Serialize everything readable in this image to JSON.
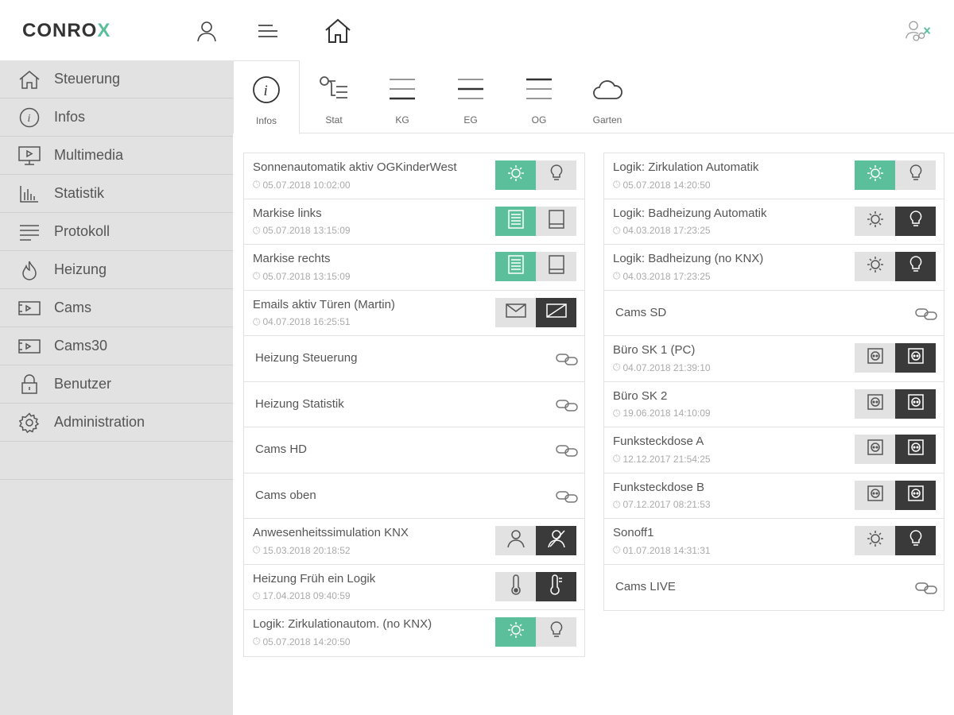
{
  "header": {
    "logo_main": "CONRO",
    "logo_accent": "X",
    "icons": [
      "user-icon",
      "menu-icon",
      "home-icon",
      "logout-icon"
    ]
  },
  "sidebar": {
    "items": [
      {
        "label": "Steuerung",
        "icon": "home-icon"
      },
      {
        "label": "Infos",
        "icon": "info-icon"
      },
      {
        "label": "Multimedia",
        "icon": "monitor-icon"
      },
      {
        "label": "Statistik",
        "icon": "bar-chart-icon"
      },
      {
        "label": "Protokoll",
        "icon": "list-icon"
      },
      {
        "label": "Heizung",
        "icon": "flame-icon"
      },
      {
        "label": "Cams",
        "icon": "camera-icon"
      },
      {
        "label": "Cams30",
        "icon": "camera-icon"
      },
      {
        "label": "Benutzer",
        "icon": "lock-icon"
      },
      {
        "label": "Administration",
        "icon": "gear-icon"
      }
    ]
  },
  "tabs": [
    {
      "label": "Infos",
      "icon": "info-icon",
      "active": true
    },
    {
      "label": "Stat",
      "icon": "status-list-icon"
    },
    {
      "label": "KG",
      "icon": "floor-lines-icon"
    },
    {
      "label": "EG",
      "icon": "floor-lines-icon"
    },
    {
      "label": "OG",
      "icon": "floor-lines-icon"
    },
    {
      "label": "Garten",
      "icon": "cloud-icon"
    }
  ],
  "left_panel": [
    {
      "name": "Sonnenautomatik aktiv OGKinderWest",
      "time": "05.07.2018 10:02:00",
      "kind": "sun"
    },
    {
      "name": "Markise links",
      "time": "05.07.2018 13:15:09",
      "kind": "awning"
    },
    {
      "name": "Markise rechts",
      "time": "05.07.2018 13:15:09",
      "kind": "awning"
    },
    {
      "name": "Emails aktiv Türen (Martin)",
      "time": "04.07.2018 16:25:51",
      "kind": "mail"
    },
    {
      "name": "Heizung Steuerung",
      "kind": "link"
    },
    {
      "name": "Heizung Statistik",
      "kind": "link"
    },
    {
      "name": "Cams HD",
      "kind": "link"
    },
    {
      "name": "Cams oben",
      "kind": "link"
    },
    {
      "name": "Anwesenheitssimulation KNX",
      "time": "15.03.2018 20:18:52",
      "kind": "presence"
    },
    {
      "name": "Heizung Früh ein Logik",
      "time": "17.04.2018 09:40:59",
      "kind": "thermo"
    },
    {
      "name": "Logik: Zirkulationautom. (no KNX)",
      "time": "05.07.2018 14:20:50",
      "kind": "sun"
    }
  ],
  "right_panel": [
    {
      "name": "Logik: Zirkulation Automatik",
      "time": "05.07.2018 14:20:50",
      "kind": "sun"
    },
    {
      "name": "Logik: Badheizung Automatik",
      "time": "04.03.2018 17:23:25",
      "kind": "bulb"
    },
    {
      "name": "Logik: Badheizung (no KNX)",
      "time": "04.03.2018 17:23:25",
      "kind": "bulb"
    },
    {
      "name": "Cams SD",
      "kind": "link"
    },
    {
      "name": "Büro SK 1 (PC)",
      "time": "04.07.2018 21:39:10",
      "kind": "socket"
    },
    {
      "name": "Büro SK 2",
      "time": "19.06.2018 14:10:09",
      "kind": "socket"
    },
    {
      "name": "Funksteckdose A",
      "time": "12.12.2017 21:54:25",
      "kind": "socket"
    },
    {
      "name": "Funksteckdose B",
      "time": "07.12.2017 08:21:53",
      "kind": "socket"
    },
    {
      "name": "Sonoff1",
      "time": "01.07.2018 14:31:31",
      "kind": "bulb"
    },
    {
      "name": "Cams LIVE",
      "kind": "link"
    }
  ],
  "colors": {
    "accent": "#5abf9a",
    "dark": "#3a3a3a",
    "grey": "#e2e2e2",
    "sidebar": "#e2e2e2"
  }
}
